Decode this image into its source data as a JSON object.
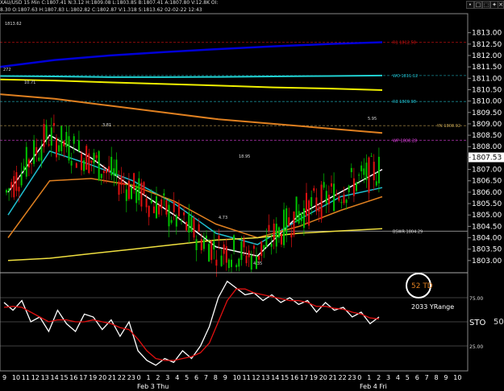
{
  "header": {
    "line1": "XAU/USD  15 Min  C:1807.41  N:3.12  H:1809.08  L:1803.85  B:1807.41  A:1807.80  V:12.8K  OI:",
    "line2": "8.30  O:1807.63  H:1807.83  L:1802.82  C:1802.87  V:1.318  S:1813.62  02-02-22  12:43"
  },
  "toolbar": {
    "buttons": [
      "•",
      "□",
      "⬚",
      "✦",
      "✕"
    ]
  },
  "colors": {
    "background": "#000000",
    "up_candle": "#00c400",
    "down_candle": "#e01010",
    "grid": "#3a3a3a"
  },
  "chart_data": [
    {
      "type": "line",
      "title": "",
      "ylim": [
        1802.5,
        1813.8
      ],
      "y_ticks": [
        "1813.00",
        "1812.50",
        "1812.00",
        "1811.50",
        "1811.00",
        "1810.50",
        "1810.00",
        "1809.50",
        "1809.00",
        "1808.50",
        "1808.00",
        "1807.53",
        "1807.00",
        "1806.50",
        "1806.00",
        "1805.50",
        "1805.00",
        "1804.50",
        "1804.00",
        "1803.50",
        "1803.00"
      ],
      "last_price": "1807.53",
      "levels": [
        {
          "name": "R1",
          "label": "R1 1812.58",
          "value": 1812.58,
          "color": "#d01010"
        },
        {
          "name": "WO",
          "label": "WO 1811.12",
          "value": 1811.12,
          "color": "#20c0d0"
        },
        {
          "name": "R3",
          "label": "R3 1809.98",
          "value": 1809.98,
          "color": "#20c0d0"
        },
        {
          "name": "YN",
          "label": "YN 1808.92",
          "value": 1808.92,
          "color": "#c0a050"
        },
        {
          "name": "WP",
          "label": "WP 1808.28",
          "value": 1808.28,
          "color": "#e040e0"
        },
        {
          "name": "BSWR",
          "label": "BSWR 1804.29",
          "value": 1804.29,
          "color": "#e0e0e0"
        }
      ],
      "annotations": [
        "1813.62",
        "272",
        "10.71",
        "3.81",
        "18.95",
        "5.95",
        "4.73",
        "4.35"
      ],
      "series": [
        {
          "color": "#0000d8",
          "values": [
            1811.5,
            1811.8,
            1812.0,
            1812.15,
            1812.28,
            1812.4,
            1812.5,
            1812.58
          ]
        },
        {
          "color": "#20d0d0",
          "values": [
            1811.1,
            1811.08,
            1811.05,
            1811.05,
            1811.06,
            1811.08,
            1811.1,
            1811.12
          ]
        },
        {
          "color": "#f0f000",
          "values": [
            1810.95,
            1810.9,
            1810.82,
            1810.75,
            1810.68,
            1810.6,
            1810.55,
            1810.48
          ]
        },
        {
          "color": "#e08020",
          "values": [
            1810.3,
            1810.1,
            1809.8,
            1809.5,
            1809.2,
            1809.0,
            1808.8,
            1808.6
          ]
        },
        {
          "color": "#ffffff",
          "values": [
            1806.0,
            1808.5,
            1807.5,
            1806.2,
            1805.0,
            1803.6,
            1803.2,
            1805.0,
            1806.0,
            1807.0
          ]
        },
        {
          "color": "#20c0d0",
          "values": [
            1805.0,
            1807.8,
            1807.2,
            1806.5,
            1805.5,
            1804.2,
            1803.7,
            1804.8,
            1805.8,
            1806.2
          ]
        },
        {
          "color": "#e08020",
          "values": [
            1804.0,
            1806.5,
            1806.6,
            1806.3,
            1805.6,
            1804.6,
            1804.0,
            1804.5,
            1805.2,
            1805.8
          ]
        },
        {
          "color": "#f0e040",
          "values": [
            1803.0,
            1803.1,
            1803.3,
            1803.5,
            1803.7,
            1803.9,
            1804.0,
            1804.2,
            1804.3,
            1804.4
          ]
        }
      ]
    },
    {
      "type": "line",
      "title": "",
      "ylabel": "STO 50.",
      "y_ticks": [
        "75.00",
        "50.",
        "25.00"
      ],
      "badge": "52 TD",
      "note": "2033 YRange",
      "series": [
        {
          "color": "#ffffff",
          "values": [
            70,
            62,
            72,
            50,
            55,
            40,
            62,
            48,
            40,
            58,
            55,
            42,
            52,
            35,
            50,
            20,
            10,
            5,
            12,
            8,
            20,
            12,
            25,
            45,
            75,
            92,
            85,
            78,
            80,
            72,
            78,
            70,
            75,
            68,
            72,
            60,
            70,
            62,
            65,
            55,
            60,
            48,
            55
          ]
        },
        {
          "color": "#e01010",
          "values": [
            65,
            66,
            65,
            60,
            55,
            50,
            52,
            52,
            50,
            50,
            52,
            50,
            48,
            44,
            42,
            32,
            20,
            12,
            10,
            10,
            12,
            14,
            18,
            28,
            50,
            72,
            84,
            84,
            80,
            78,
            76,
            74,
            72,
            72,
            70,
            66,
            66,
            64,
            63,
            60,
            58,
            54,
            53
          ]
        }
      ]
    }
  ],
  "x_axis": {
    "hours": [
      "9",
      "10",
      "11",
      "12",
      "13",
      "14",
      "15",
      "16",
      "17",
      "19",
      "20",
      "21",
      "22",
      "23",
      "0",
      "1",
      "2",
      "3",
      "4",
      "5",
      "6",
      "7",
      "8",
      "9",
      "10",
      "11",
      "12",
      "13",
      "14",
      "15",
      "16",
      "17",
      "19",
      "20",
      "21",
      "22",
      "23",
      "0",
      "1",
      "2",
      "3",
      "4",
      "5",
      "6",
      "7",
      "8",
      "9",
      "10",
      "11"
    ],
    "date_labels": [
      "Feb 3 Thu",
      "Feb 4 Fri"
    ]
  }
}
